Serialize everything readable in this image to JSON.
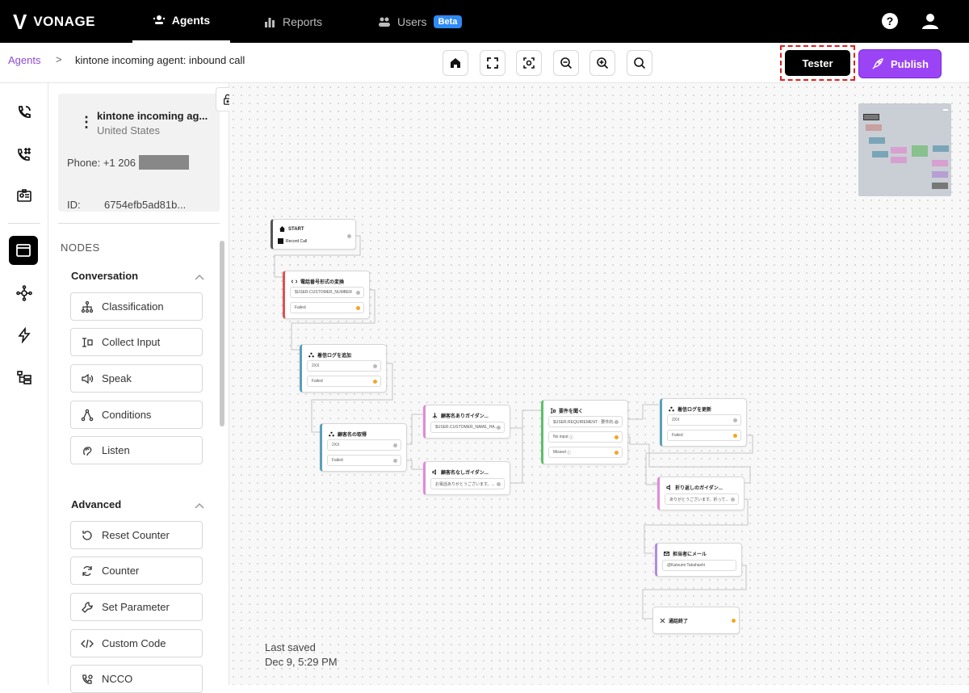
{
  "topnav": {
    "logo": "VONAGE",
    "tabs": [
      {
        "label": "Agents",
        "active": true
      },
      {
        "label": "Reports",
        "active": false
      },
      {
        "label": "Users",
        "active": false,
        "badge": "Beta"
      }
    ]
  },
  "breadcrumb": {
    "root": "Agents",
    "separator": ">",
    "current": "kintone incoming agent: inbound call"
  },
  "toolbar": {
    "tester_label": "Tester",
    "publish_label": "Publish"
  },
  "agent": {
    "name": "kintone incoming ag...",
    "country": "United States",
    "phone_label": "Phone:",
    "phone_prefix": "+1 206",
    "id_label": "ID:",
    "id_value": "6754efb5ad81b..."
  },
  "palette": {
    "heading": "NODES",
    "conversation": {
      "title": "Conversation",
      "items": [
        "Classification",
        "Collect Input",
        "Speak",
        "Conditions",
        "Listen"
      ]
    },
    "advanced": {
      "title": "Advanced",
      "items": [
        "Reset Counter",
        "Counter",
        "Set Parameter",
        "Custom Code",
        "NCCO"
      ]
    }
  },
  "canvas": {
    "last_saved_label": "Last saved",
    "last_saved_value": "Dec 9, 5:29 PM",
    "nodes": {
      "start": {
        "title": "START",
        "row": "Record Call"
      },
      "n1": {
        "title": "電話番号形式の変換",
        "rows": [
          "$USER.CUSTOMER_NUMBER",
          "Failed"
        ]
      },
      "n2": {
        "title": "着信ログを追加",
        "rows": [
          "2XX",
          "Failed"
        ]
      },
      "n3": {
        "title": "顧客名の取得",
        "rows": [
          "2XX",
          "Failed"
        ]
      },
      "n4": {
        "title": "顧客名ありガイダン...",
        "rows": [
          "$USER.CUSTOMER_NAME_HA..."
        ]
      },
      "n5": {
        "title": "顧客名なしガイダン...",
        "rows": [
          "お電話ありがとうございます。..."
        ]
      },
      "n6": {
        "title": "要件を聞く",
        "rows": [
          "$USER.REQUIREMENT : 要件的...",
          "No input",
          "Missed"
        ]
      },
      "n7": {
        "title": "着信ログを更新",
        "rows": [
          "2XX",
          "Failed"
        ]
      },
      "n8": {
        "title": "折り返しのガイダン...",
        "rows": [
          "ありがとうございます。折って..."
        ]
      },
      "n9": {
        "title": "担当者にメール",
        "rows": [
          "@Katsumi Takahashi"
        ]
      },
      "n10": {
        "title": "通話終了"
      }
    }
  },
  "colors": {
    "accent": "#9b44f5",
    "link": "#8a4bd6",
    "highlight": "#e02020"
  }
}
